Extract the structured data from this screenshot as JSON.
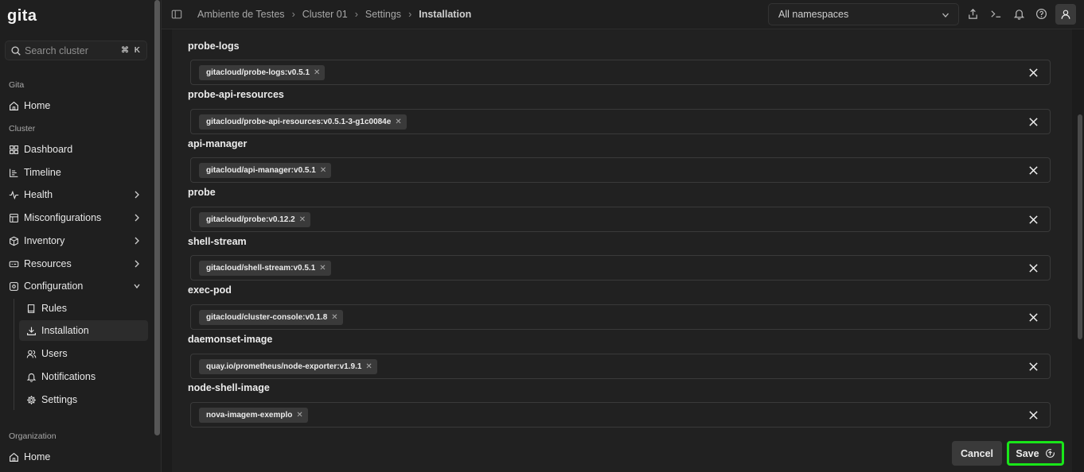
{
  "app": {
    "logo": "gita"
  },
  "search": {
    "placeholder": "Search cluster",
    "shortcut": "⌘ K"
  },
  "sidebar": {
    "sections": {
      "gita": "Gita",
      "cluster": "Cluster",
      "organization": "Organization"
    },
    "items": [
      {
        "label": "Home",
        "icon": "home-icon"
      },
      {
        "label": "Dashboard",
        "icon": "dashboard-icon"
      },
      {
        "label": "Timeline",
        "icon": "timeline-icon"
      },
      {
        "label": "Health",
        "icon": "health-icon"
      },
      {
        "label": "Misconfigurations",
        "icon": "misconfig-icon"
      },
      {
        "label": "Inventory",
        "icon": "cube-icon"
      },
      {
        "label": "Resources",
        "icon": "resources-icon"
      },
      {
        "label": "Configuration",
        "icon": "config-icon"
      },
      {
        "label": "Rules",
        "icon": "book-icon"
      },
      {
        "label": "Installation",
        "icon": "download-icon"
      },
      {
        "label": "Users",
        "icon": "users-icon"
      },
      {
        "label": "Notifications",
        "icon": "bell-icon"
      },
      {
        "label": "Settings",
        "icon": "gear-icon"
      },
      {
        "label": "Home",
        "icon": "home-icon"
      }
    ]
  },
  "breadcrumb": [
    "Ambiente de Testes",
    "Cluster 01",
    "Settings",
    "Installation"
  ],
  "namespace": {
    "selected": "All namespaces"
  },
  "fields": [
    {
      "label": "probe-logs",
      "tag": "gitacloud/probe-logs:v0.5.1"
    },
    {
      "label": "probe-api-resources",
      "tag": "gitacloud/probe-api-resources:v0.5.1-3-g1c0084e"
    },
    {
      "label": "api-manager",
      "tag": "gitacloud/api-manager:v0.5.1"
    },
    {
      "label": "probe",
      "tag": "gitacloud/probe:v0.12.2"
    },
    {
      "label": "shell-stream",
      "tag": "gitacloud/shell-stream:v0.5.1"
    },
    {
      "label": "exec-pod",
      "tag": "gitacloud/cluster-console:v0.1.8"
    },
    {
      "label": "daemonset-image",
      "tag": "quay.io/prometheus/node-exporter:v1.9.1"
    },
    {
      "label": "node-shell-image",
      "tag": "nova-imagem-exemplo"
    }
  ],
  "actions": {
    "cancel": "Cancel",
    "save": "Save"
  },
  "colors": {
    "highlight": "#19e619",
    "background": "#1c1c1c"
  }
}
